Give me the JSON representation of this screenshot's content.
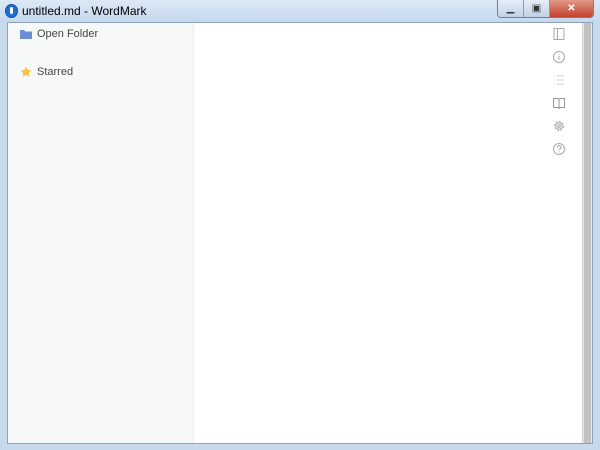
{
  "window": {
    "title": "untitled.md - WordMark",
    "controls": {
      "minimize": "minimize",
      "maximize": "maximize",
      "close": "close"
    }
  },
  "sidebar": {
    "items": [
      {
        "label": "Open Folder",
        "icon": "folder-icon",
        "color": "#6b8fd6"
      },
      {
        "label": "Starred",
        "icon": "star-icon",
        "color": "#f4c542"
      }
    ]
  },
  "toolbar": {
    "icons": [
      "sidebar-toggle-icon",
      "info-icon",
      "list-icon",
      "book-icon",
      "gear-icon",
      "help-icon"
    ]
  }
}
